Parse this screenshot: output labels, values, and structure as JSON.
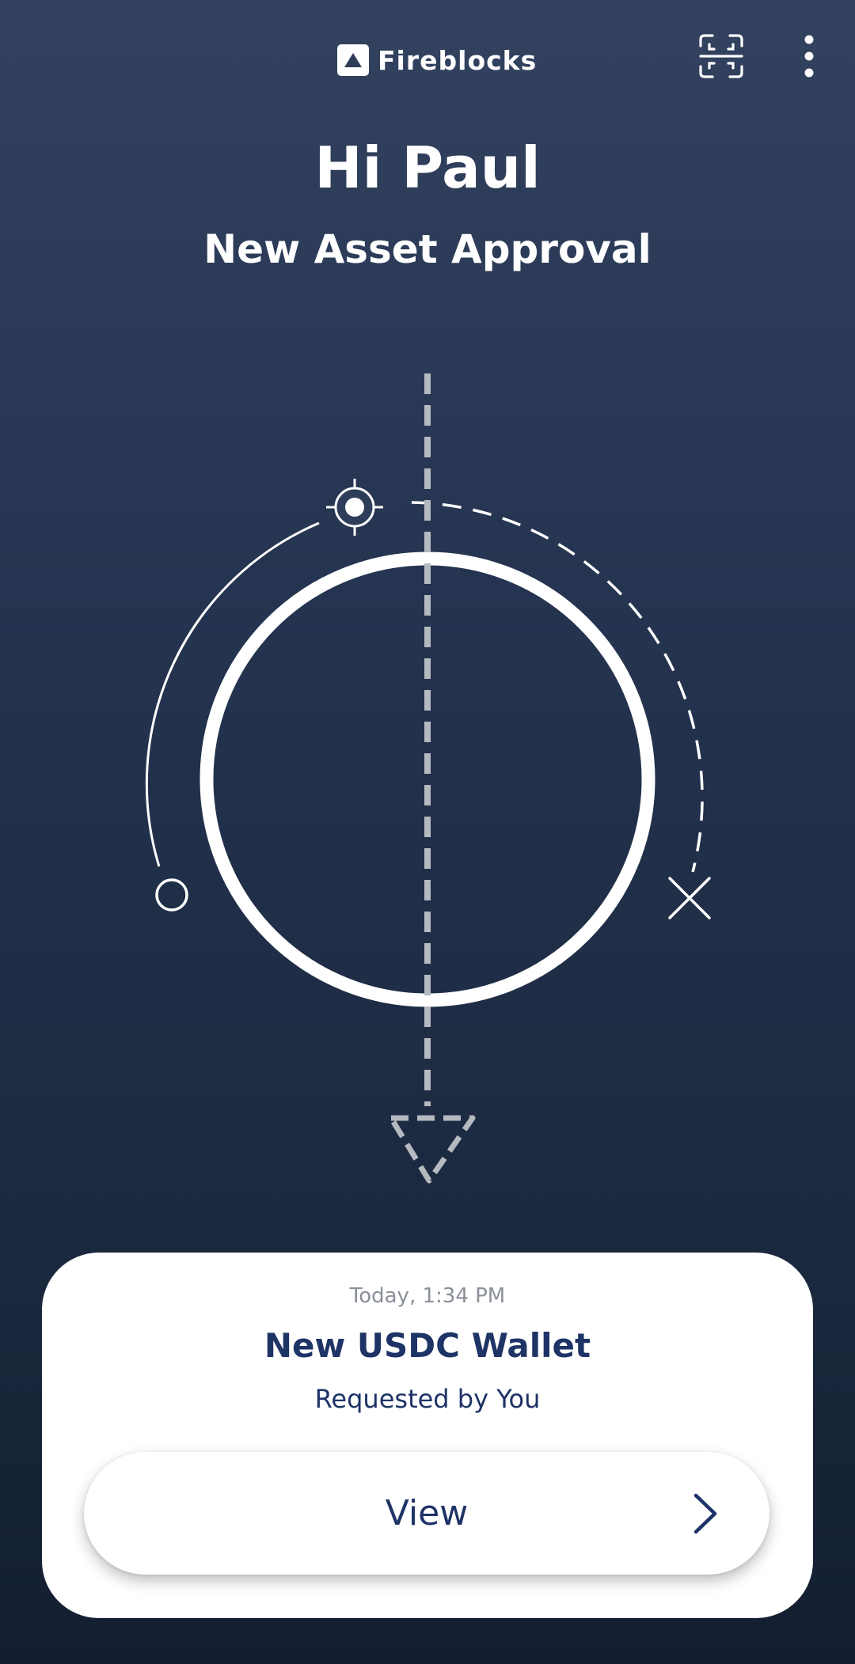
{
  "header": {
    "brand_name": "Fireblocks",
    "icons": {
      "logo": "triangle-logo-icon",
      "scan": "scan-qr-icon",
      "menu": "more-vertical-icon"
    }
  },
  "greeting": "Hi Paul",
  "subtitle": "New Asset Approval",
  "illustration": {
    "icons": [
      "target-icon",
      "circle-icon",
      "close-x-icon",
      "arrow-down-triangle-icon"
    ]
  },
  "request_card": {
    "timestamp": "Today, 1:34 PM",
    "title": "New USDC Wallet",
    "requested_by": "Requested by You",
    "view_label": "View",
    "chevron_icon": "chevron-right-icon"
  },
  "colors": {
    "background_top": "#32425f",
    "background_bottom": "#131f30",
    "card_background": "#ffffff",
    "accent_text": "#1e3366",
    "muted_text": "#8a8f98",
    "dashed_line": "#b5b9c0"
  }
}
